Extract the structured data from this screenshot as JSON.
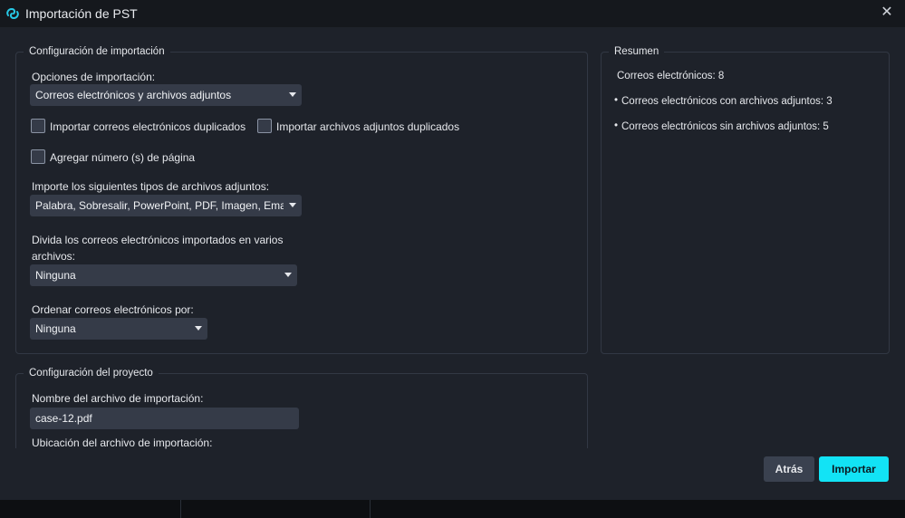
{
  "window": {
    "title": "Importación de PST",
    "close_icon": "close-icon",
    "logo_icon": "app-logo-icon"
  },
  "import_config": {
    "legend": "Configuración de importación",
    "options_label": "Opciones de importación:",
    "options_value": "Correos electrónicos y archivos adjuntos",
    "dup_emails_label": "Importar correos electrónicos duplicados",
    "dup_emails_checked": false,
    "dup_attachments_label": "Importar archivos adjuntos duplicados",
    "dup_attachments_checked": false,
    "page_numbers_label": "Agregar número (s) de página",
    "page_numbers_checked": false,
    "attachment_types_label": "Importe los siguientes tipos de archivos adjuntos:",
    "attachment_types_value": "Palabra, Sobresalir, PowerPoint, PDF, Imagen, Email,",
    "split_label_line1": "Divida los correos electrónicos importados en varios",
    "split_label_line2": "archivos:",
    "split_value": "Ninguna",
    "sort_label": "Ordenar correos electrónicos por:",
    "sort_value": "Ninguna"
  },
  "summary": {
    "legend": "Resumen",
    "total": "Correos electrónicos: 8",
    "with_attachments": "Correos electrónicos con archivos adjuntos: 3",
    "without_attachments": "Correos electrónicos sin archivos adjuntos: 5"
  },
  "project_config": {
    "legend": "Configuración del proyecto",
    "filename_label": "Nombre del archivo de importación:",
    "filename_value": "case-12.pdf",
    "location_label": "Ubicación del archivo de importación:"
  },
  "buttons": {
    "back": "Atrás",
    "import": "Importar"
  },
  "colors": {
    "accent": "#12e3f5",
    "background": "#1e222a",
    "titlebar": "#15181d",
    "field": "#353b48"
  }
}
